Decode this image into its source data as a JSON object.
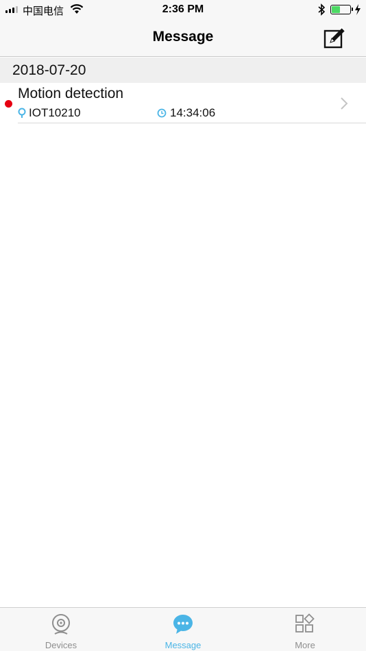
{
  "status_bar": {
    "carrier": "中国电信",
    "time": "2:36 PM",
    "battery_level": 0.45
  },
  "nav": {
    "title": "Message"
  },
  "sections": [
    {
      "date": "2018-07-20",
      "messages": [
        {
          "title": "Motion detection",
          "device": "IOT10210",
          "time": "14:34:06",
          "unread": true
        }
      ]
    }
  ],
  "tab_bar": {
    "items": [
      {
        "label": "Devices",
        "icon": "camera-icon",
        "active": false
      },
      {
        "label": "Message",
        "icon": "chat-bubble-icon",
        "active": true
      },
      {
        "label": "More",
        "icon": "grid-icon",
        "active": false
      }
    ]
  },
  "colors": {
    "accent": "#4bb5e6",
    "unread_dot": "#e60012",
    "battery": "#4cd964"
  }
}
